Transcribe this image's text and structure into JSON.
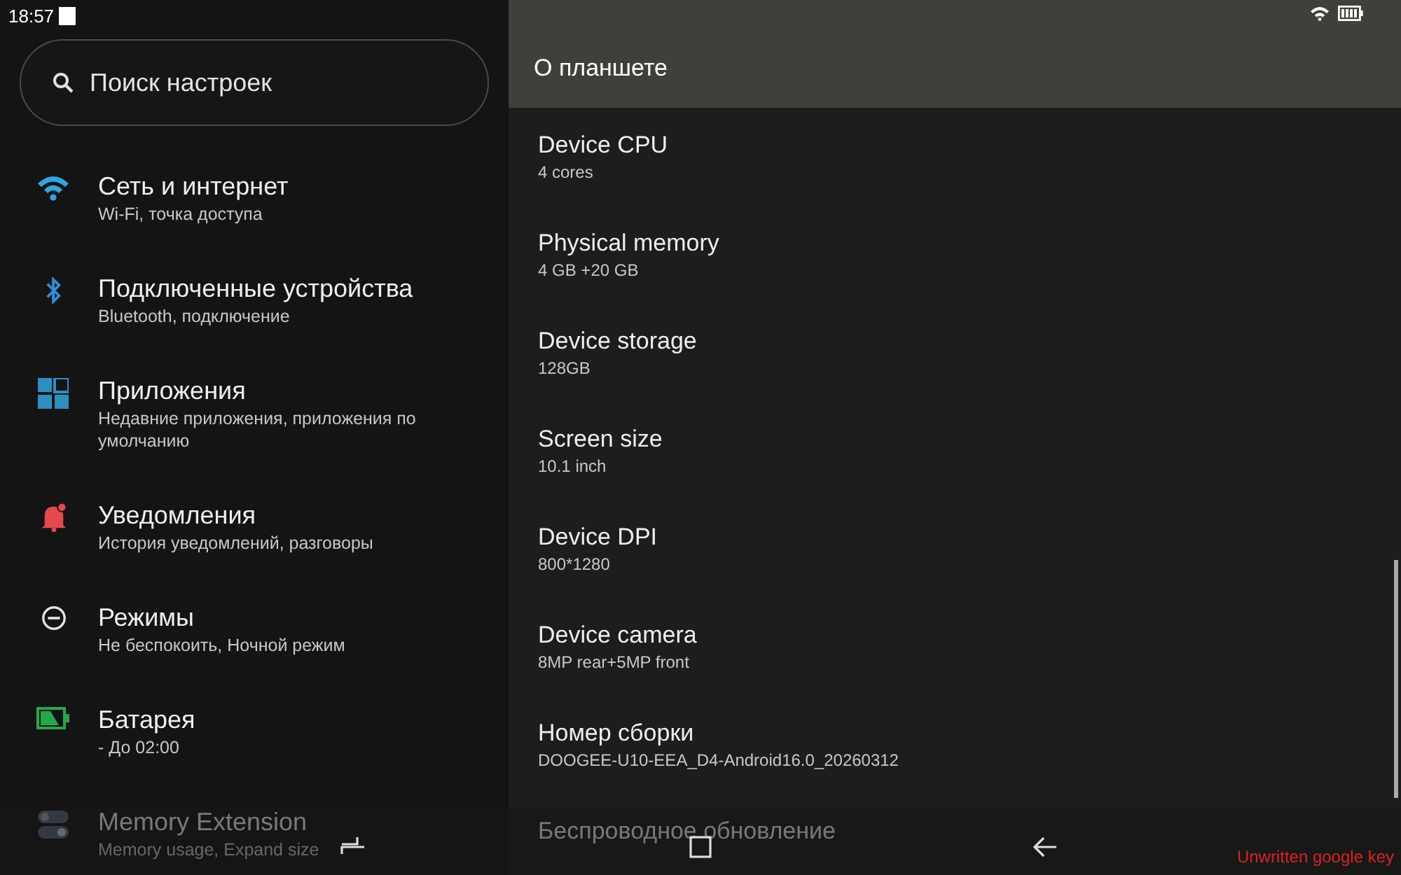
{
  "status_bar": {
    "time": "18:57"
  },
  "search": {
    "placeholder": "Поиск настроек"
  },
  "settings": [
    {
      "kind": "network",
      "title": "Сеть и интернет",
      "subtitle": "Wi-Fi, точка доступа"
    },
    {
      "kind": "bluetooth",
      "title": "Подключенные устройства",
      "subtitle": "Bluetooth, подключение"
    },
    {
      "kind": "apps",
      "title": "Приложения",
      "subtitle": "Недавние приложения, приложения по умолчанию"
    },
    {
      "kind": "notifications",
      "title": "Уведомления",
      "subtitle": "История уведомлений, разговоры"
    },
    {
      "kind": "modes",
      "title": "Режимы",
      "subtitle": "Не беспокоить, Ночной режим"
    },
    {
      "kind": "battery",
      "title": "Батарея",
      "subtitle": " - До 02:00"
    },
    {
      "kind": "memory",
      "title": "Memory Extension",
      "subtitle": "Memory usage, Expand size"
    }
  ],
  "page": {
    "title": "О планшете"
  },
  "details": [
    {
      "title": "Device CPU",
      "value": "4 cores"
    },
    {
      "title": "Physical memory",
      "value": "4 GB +20 GB"
    },
    {
      "title": "Device storage",
      "value": "128GB"
    },
    {
      "title": "Screen size",
      "value": "10.1 inch"
    },
    {
      "title": "Device DPI",
      "value": "800*1280"
    },
    {
      "title": "Device camera",
      "value": "8MP rear+5MP front"
    },
    {
      "title": "Номер сборки",
      "value": "DOOGEE-U10-EEA_D4-Android16.0_20260312"
    },
    {
      "title": "Беспроводное обновление"
    }
  ],
  "overlay_notice": "Unwritten google key"
}
